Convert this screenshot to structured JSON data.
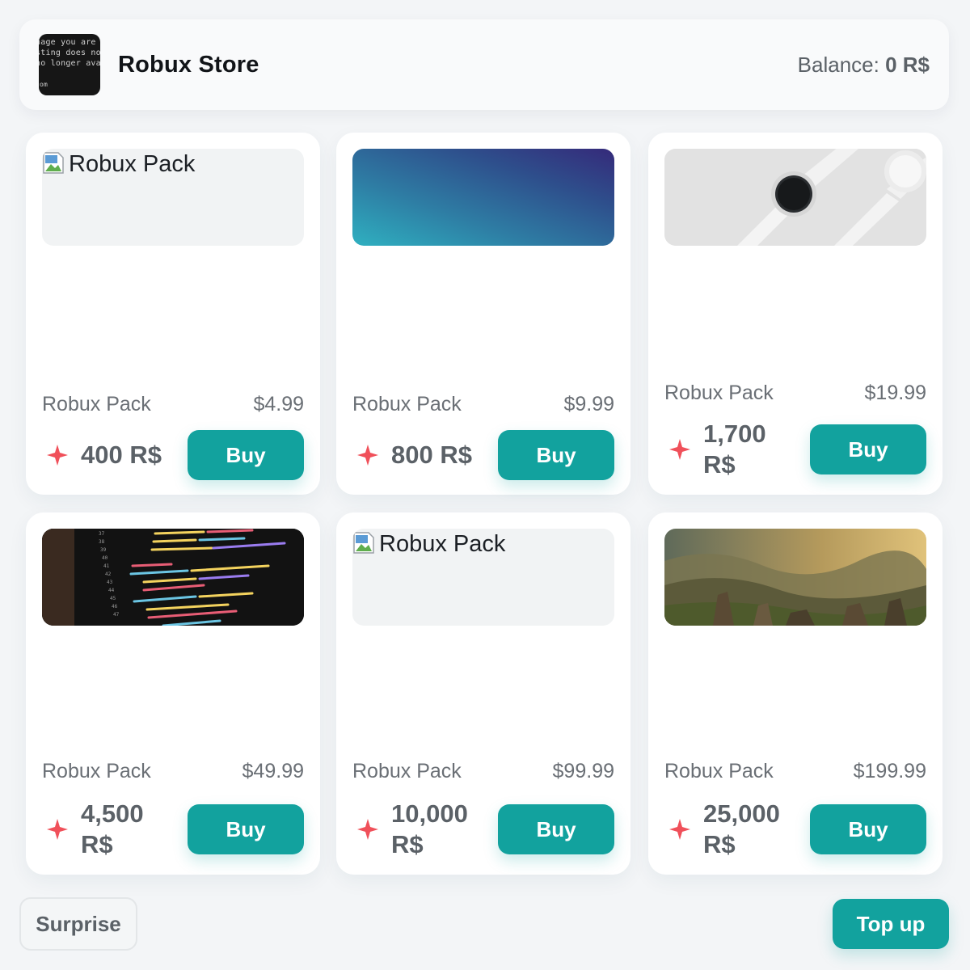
{
  "header": {
    "logo_text": [
      "nage you are",
      "sting does no",
      "no longer avail",
      "com"
    ],
    "title": "Robux Store",
    "balance_label": "Balance:",
    "balance_value": "0 R$"
  },
  "products": [
    {
      "name": "Robux Pack",
      "price": "$4.99",
      "amount": "400 R$",
      "buy_label": "Buy",
      "image": "broken",
      "image_alt": "Robux Pack"
    },
    {
      "name": "Robux Pack",
      "price": "$9.99",
      "amount": "800 R$",
      "buy_label": "Buy",
      "image": "gradient"
    },
    {
      "name": "Robux Pack",
      "price": "$19.99",
      "amount_line1": "1,700",
      "amount_line2": "R$",
      "buy_label": "Buy",
      "image": "watch-photo"
    },
    {
      "name": "Robux Pack",
      "price": "$49.99",
      "amount_line1": "4,500",
      "amount_line2": "R$",
      "buy_label": "Buy",
      "image": "code-photo"
    },
    {
      "name": "Robux Pack",
      "price": "$99.99",
      "amount_line1": "10,000",
      "amount_line2": "R$",
      "buy_label": "Buy",
      "image": "broken",
      "image_alt": "Robux Pack"
    },
    {
      "name": "Robux Pack",
      "price": "$199.99",
      "amount_line1": "25,000",
      "amount_line2": "R$",
      "buy_label": "Buy",
      "image": "landscape-photo"
    }
  ],
  "footer": {
    "surprise_label": "Surprise",
    "topup_label": "Top up"
  },
  "colors": {
    "accent": "#12a29e",
    "spark": "#f0505a",
    "background": "#f3f5f7"
  }
}
